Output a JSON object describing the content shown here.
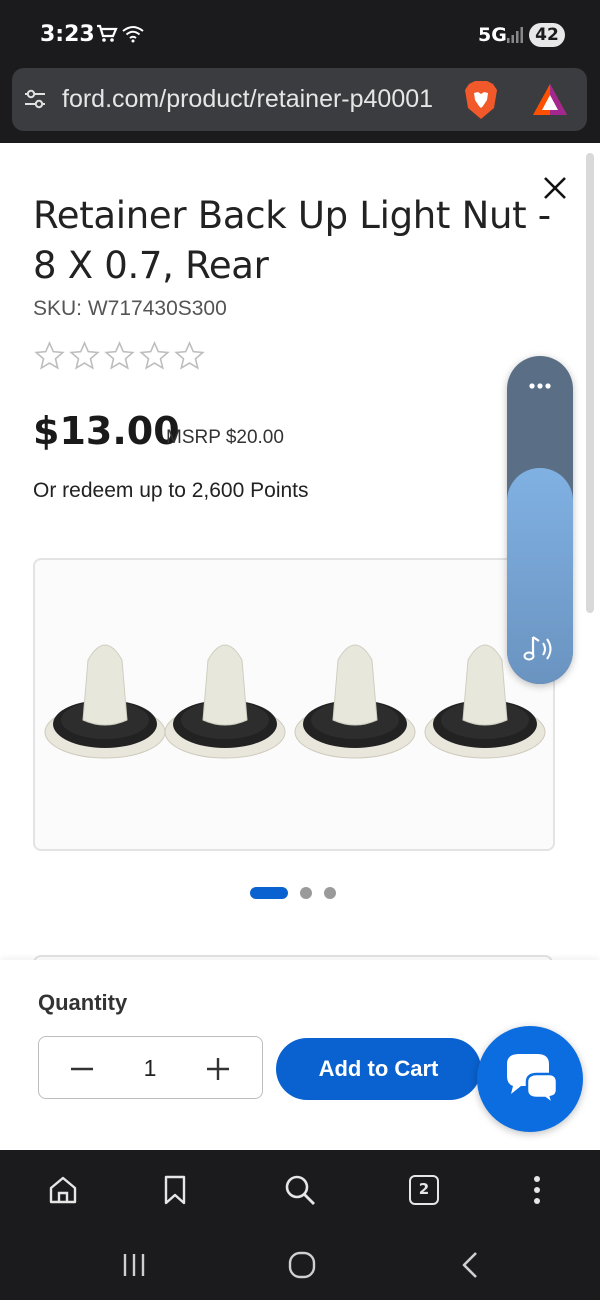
{
  "status_bar": {
    "time": "3:23",
    "network": "5G",
    "battery": "42"
  },
  "browser": {
    "url": "ford.com/product/retainer-p40001",
    "tab_count": "2"
  },
  "product": {
    "title": "Retainer Back Up Light Nut - 8 X 0.7, Rear",
    "sku": "SKU: W717430S300",
    "rating": 0,
    "rating_max": 5,
    "price": "$13.00",
    "msrp": "MSRP $20.00",
    "points": "Or redeem up to 2,600 Points",
    "image_count": 3,
    "active_image": 1
  },
  "purchase": {
    "quantity_label": "Quantity",
    "quantity": "1",
    "add_to_cart": "Add to Cart"
  },
  "media_controls": {
    "volume_level": 0.66
  },
  "colors": {
    "accent": "#0a62d0",
    "chat_button": "#0c6de0",
    "media_pill": "#5a6f86",
    "media_level": "#80b1e3"
  }
}
